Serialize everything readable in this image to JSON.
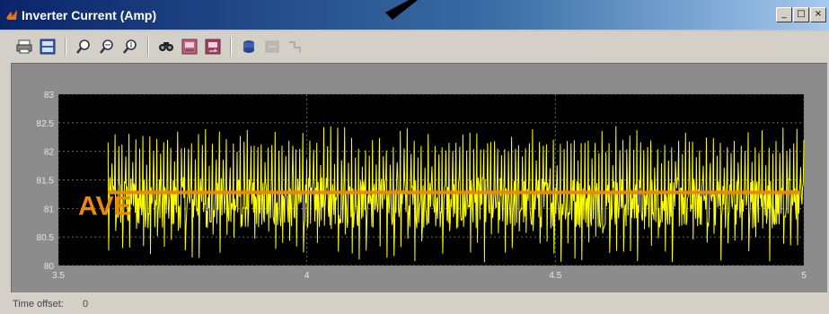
{
  "window": {
    "title": "Inverter Current (Amp)",
    "controls": {
      "minimize": "_",
      "maximize": "□",
      "close": "×"
    }
  },
  "toolbar": {
    "items": [
      {
        "icon": "print-icon"
      },
      {
        "icon": "parameters-icon"
      },
      {
        "icon": "zoom-icon"
      },
      {
        "icon": "zoom-x-icon"
      },
      {
        "icon": "zoom-y-icon"
      },
      {
        "icon": "autoscale-icon"
      },
      {
        "icon": "save-axes-icon"
      },
      {
        "icon": "restore-axes-icon"
      },
      {
        "icon": "floating-scope-icon"
      },
      {
        "icon": "lock-axes-icon",
        "disabled": true
      },
      {
        "icon": "signal-selection-icon",
        "disabled": true
      }
    ]
  },
  "status": {
    "label": "Time offset:",
    "value": "0"
  },
  "chart_data": {
    "type": "line",
    "xlim": [
      3.5,
      5
    ],
    "ylim": [
      80,
      83
    ],
    "xticks": [
      3.5,
      4,
      4.5,
      5
    ],
    "xtick_labels": [
      "3.5",
      "4",
      "4.5",
      "5"
    ],
    "yticks": [
      80,
      80.5,
      81,
      81.5,
      82,
      82.5,
      83
    ],
    "ytick_labels": [
      "80",
      "80.5",
      "81",
      "81.5",
      "82",
      "82.5",
      "83"
    ],
    "grid": true,
    "background": "#000000",
    "series": [
      {
        "color": "#ffff00",
        "x_start": 3.6,
        "x_end": 5,
        "center": 81.1,
        "peak_high": 82.45,
        "peak_low": 80.05
      }
    ],
    "annotation": {
      "text": "AVE",
      "value": 81.28,
      "x_start": 3.6,
      "x_end": 4.99,
      "color": "#e8890c"
    }
  }
}
